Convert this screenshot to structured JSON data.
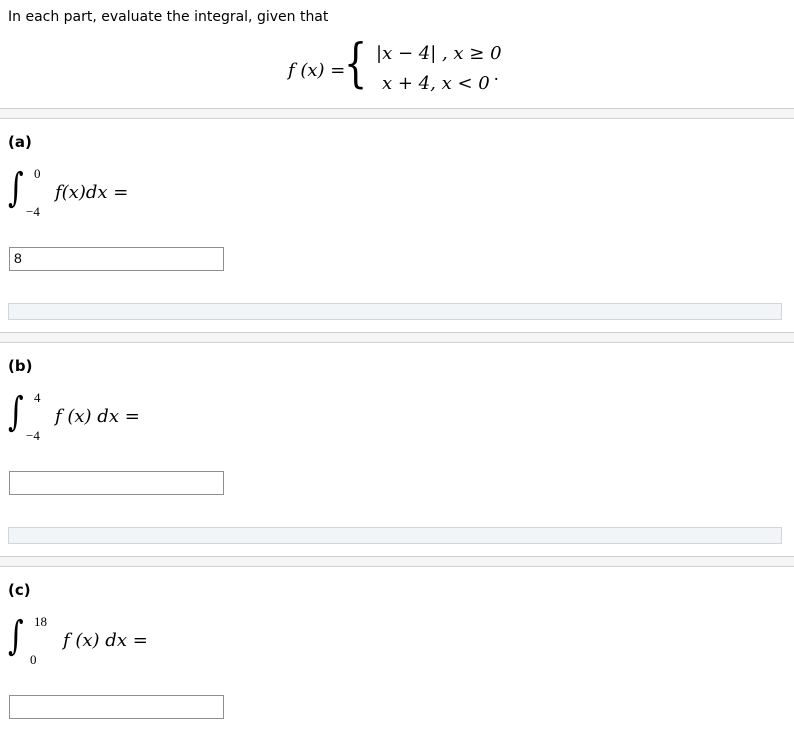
{
  "intro": "In each part, evaluate the integral, given that",
  "function_def": {
    "lhs": "f (x) =",
    "case1": "|x − 4| , x ≥ 0",
    "case2": "x + 4, x < 0",
    "trailing": "."
  },
  "parts": [
    {
      "label": "(a)",
      "upper": "0",
      "lower": "−4",
      "integrand": "f(x)dx =",
      "answer_value": "8"
    },
    {
      "label": "(b)",
      "upper": "4",
      "lower": "−4",
      "integrand": "f (x) dx =",
      "answer_value": ""
    },
    {
      "label": "(c)",
      "upper": "18",
      "lower": "0",
      "integrand": "f (x) dx =",
      "answer_value": ""
    }
  ]
}
